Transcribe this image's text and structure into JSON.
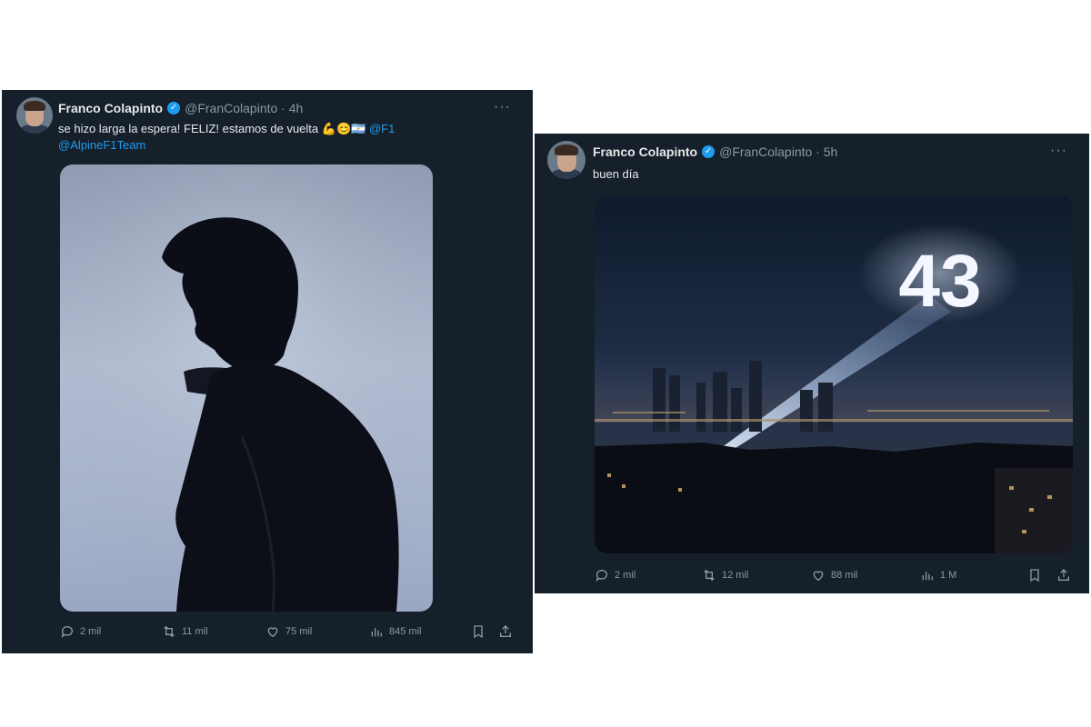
{
  "tweets": [
    {
      "name": "Franco Colapinto",
      "meta": "@FranColapinto · 4h",
      "text": "se hizo larga la espera! FELIZ! estamos de vuelta 💪😊🇦🇷",
      "mention1": "@F1",
      "mention2": "@AlpineF1Team",
      "replies": "2 mil",
      "retweets": "11 mil",
      "likes": "75 mil",
      "views": "845 mil"
    },
    {
      "name": "Franco Colapinto",
      "meta": "@FranColapinto · 5h",
      "text": "buen día",
      "image_text": "43",
      "replies": "2 mil",
      "retweets": "12 mil",
      "likes": "88 mil",
      "views": "1 M"
    }
  ],
  "icons": [
    "verified-badge-icon",
    "more-options-icon",
    "reply-icon",
    "retweet-icon",
    "like-icon",
    "views-icon",
    "bookmark-icon",
    "share-icon"
  ],
  "colors": {
    "background": "#15202b",
    "text": "#e7e9ea",
    "muted": "#8b98a5",
    "link": "#1d9bf0"
  }
}
